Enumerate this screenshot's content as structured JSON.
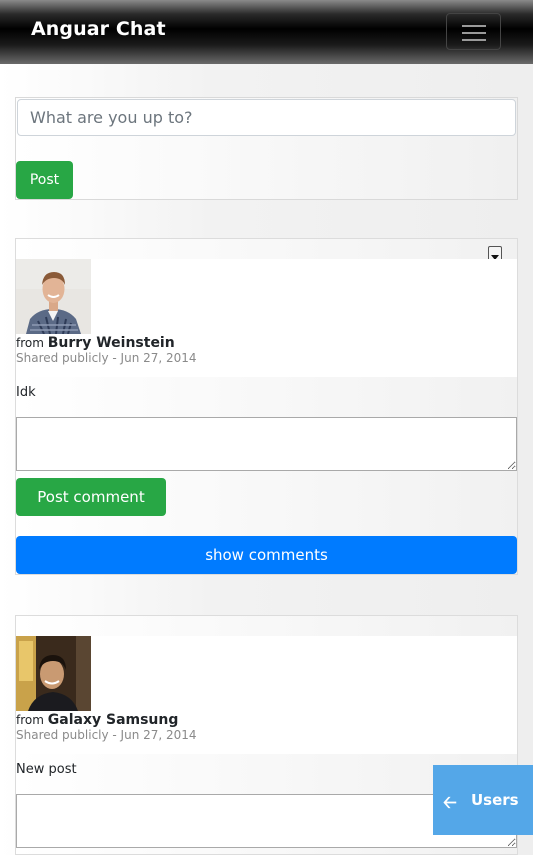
{
  "navbar": {
    "brand": "Anguar Chat",
    "menu_icon": "hamburger-icon"
  },
  "composer": {
    "placeholder": "What are you up to?",
    "value": "",
    "post_label": "Post"
  },
  "posts": [
    {
      "from_label": "from",
      "author": "Burry Weinstein",
      "meta": "Shared publicly - Jun 27, 2014",
      "text": "Idk",
      "comment_value": "",
      "post_comment_label": "Post comment",
      "show_comments_label": "show comments",
      "menu_icon": "caret-down-icon"
    },
    {
      "from_label": "from",
      "author": "Galaxy Samsung",
      "meta": "Shared publicly - Jun 27, 2014",
      "text": "New post",
      "comment_value": ""
    }
  ],
  "users_button": {
    "label": "Users",
    "icon": "arrow-left-icon"
  },
  "colors": {
    "post_green": "#28a745",
    "show_comments_blue": "#007bff",
    "users_button_blue": "#54a7e8"
  }
}
